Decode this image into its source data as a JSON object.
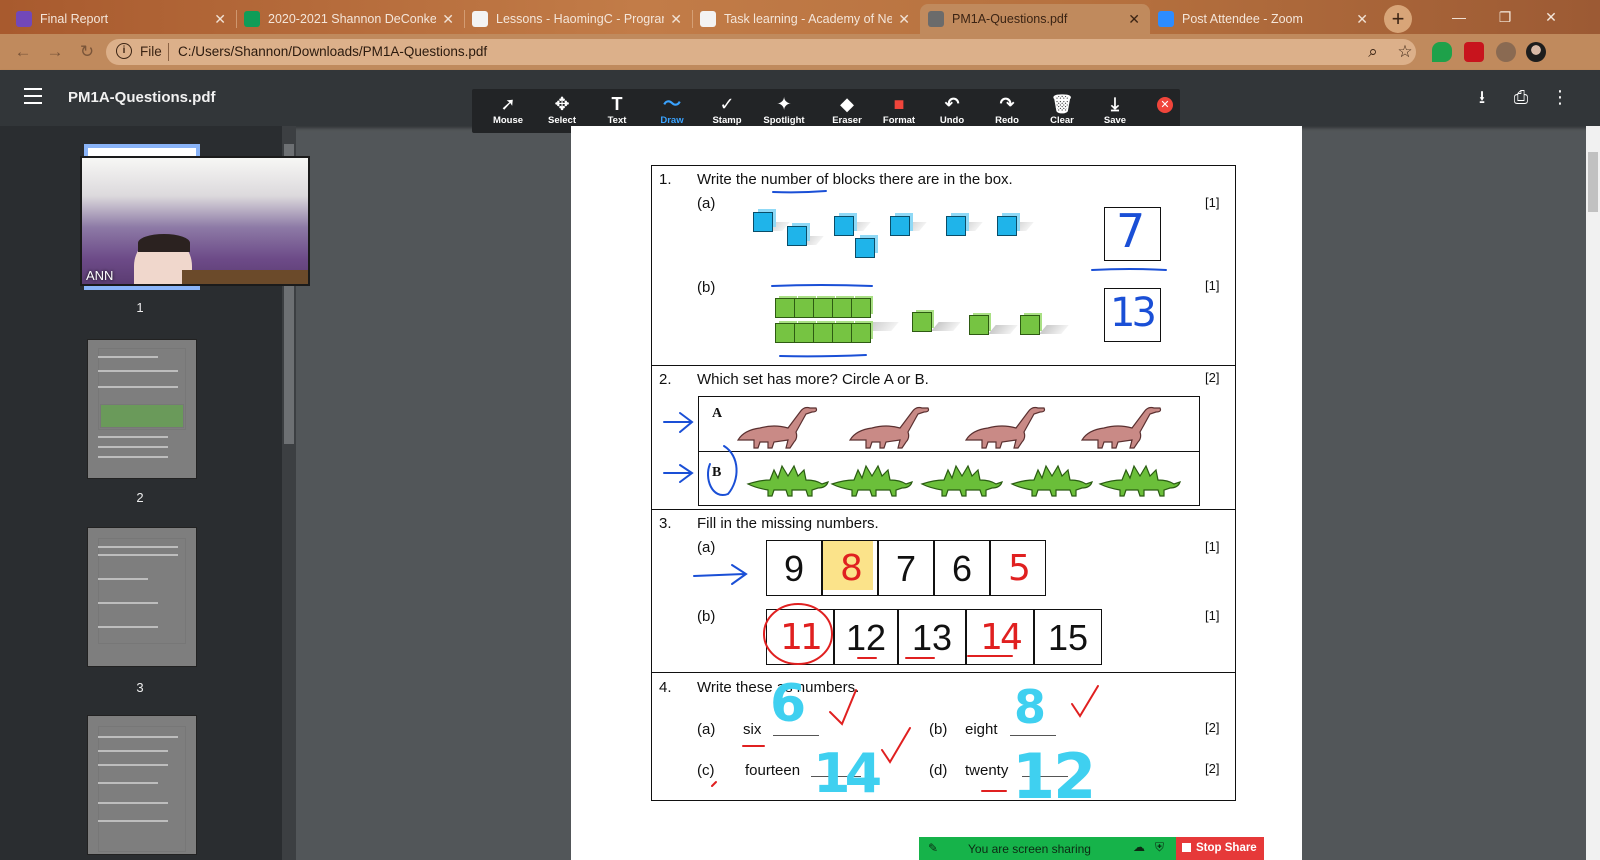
{
  "tabs": [
    {
      "title": "Final Report",
      "icon": "forms-icon",
      "color": "#7248b9"
    },
    {
      "title": "2020-2021 Shannon DeConkey",
      "icon": "sheets-icon",
      "color": "#0f9d58"
    },
    {
      "title": "Lessons - HaomingC - Program",
      "icon": "haoming-icon",
      "color": "#f3f3f3"
    },
    {
      "title": "Task learning - Academy of Ne",
      "icon": "academy-icon",
      "color": "#f3f3f3"
    },
    {
      "title": "PM1A-Questions.pdf",
      "icon": "pdf-globe-icon",
      "color": "#6b6b6b"
    },
    {
      "title": "Post Attendee - Zoom",
      "icon": "zoom-icon",
      "color": "#2d8cff"
    }
  ],
  "address": {
    "scheme_label": "File",
    "url": "C:/Users/Shannon/Downloads/PM1A-Questions.pdf"
  },
  "pdf": {
    "filename": "PM1A-Questions.pdf"
  },
  "annotation_tools": [
    {
      "label": "Mouse",
      "glyph": "➚"
    },
    {
      "label": "Select",
      "glyph": "✥"
    },
    {
      "label": "Text",
      "glyph": "T"
    },
    {
      "label": "Draw",
      "glyph": "〜"
    },
    {
      "label": "Stamp",
      "glyph": "✓"
    },
    {
      "label": "Spotlight",
      "glyph": "✦"
    },
    {
      "label": "Eraser",
      "glyph": "◆"
    },
    {
      "label": "Format",
      "glyph": "■"
    },
    {
      "label": "Undo",
      "glyph": "↶"
    },
    {
      "label": "Redo",
      "glyph": "↷"
    },
    {
      "label": "Clear",
      "glyph": "🗑"
    },
    {
      "label": "Save",
      "glyph": "⤓"
    }
  ],
  "sidebar": {
    "page_numbers": [
      "1",
      "2",
      "3"
    ]
  },
  "video": {
    "participant_name": "ANN"
  },
  "worksheet": {
    "q1": {
      "num": "1.",
      "text": "Write the number of blocks there are in the box.",
      "a": "(a)",
      "b": "(b)",
      "mark_a": "[1]",
      "mark_b": "[1]",
      "answer_a": "7",
      "answer_b": "13"
    },
    "q2": {
      "num": "2.",
      "text": "Which set has more? Circle A or B.",
      "mark": "[2]",
      "set_a": "A",
      "set_b": "B"
    },
    "q3": {
      "num": "3.",
      "text": "Fill in the missing numbers.",
      "a": "(a)",
      "b": "(b)",
      "mark_a": "[1]",
      "mark_b": "[1]",
      "row_a": [
        "9",
        "8",
        "7",
        "6",
        "5"
      ],
      "row_b": [
        "11",
        "12",
        "13",
        "14",
        "15"
      ]
    },
    "q4": {
      "num": "4.",
      "text": "Write these as numbers.",
      "items": [
        {
          "label": "(a)",
          "word": "six",
          "answer": "6",
          "mark": ""
        },
        {
          "label": "(b)",
          "word": "eight",
          "answer": "8",
          "mark": "[2]"
        },
        {
          "label": "(c)",
          "word": "fourteen",
          "answer": "14",
          "mark": ""
        },
        {
          "label": "(d)",
          "word": "twenty",
          "answer": "12",
          "mark": "[2]"
        }
      ]
    }
  },
  "share_banner": {
    "text": "You are screen sharing",
    "stop_label": "Stop Share"
  },
  "colors": {
    "pen_blue": "#1a4fd6",
    "pen_red": "#e02020",
    "pen_cyan": "#3fd0f0",
    "highlight": "#fbe38a"
  }
}
